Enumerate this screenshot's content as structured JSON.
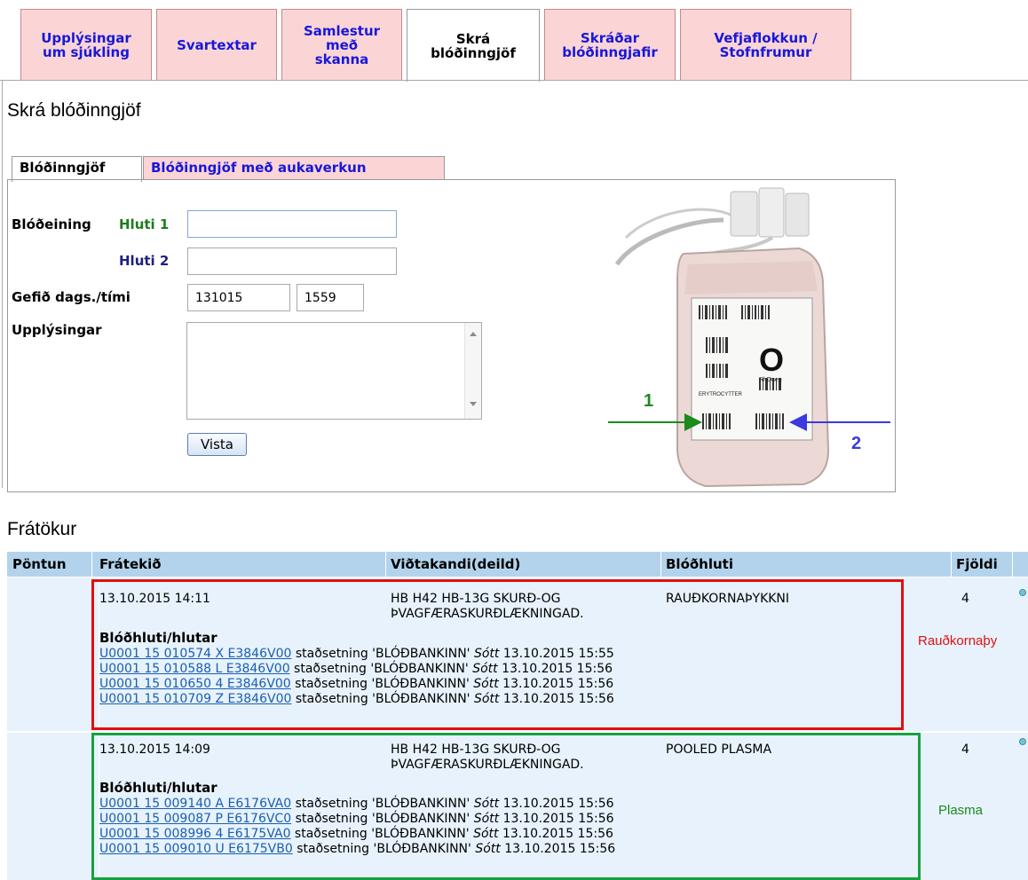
{
  "top_tabs": [
    {
      "label": "Upplýsingar\num sjúkling",
      "active": false
    },
    {
      "label": "Svartextar",
      "active": false
    },
    {
      "label": "Samlestur\nmeð\nskanna",
      "active": false
    },
    {
      "label": "Skrá\nblóðinngjöf",
      "active": true
    },
    {
      "label": "Skráðar\nblóðinngjafir",
      "active": false
    },
    {
      "label": "Vefjaflokkun /\nStofnfrumur",
      "active": false
    }
  ],
  "page_title": "Skrá blóðinngjöf",
  "inner_tabs": [
    {
      "label": "Blóðinngjöf",
      "active": true
    },
    {
      "label": "Blóðinngjöf með aukaverkun",
      "active": false
    }
  ],
  "form": {
    "unit_label": "Blóðeining",
    "part1_label": "Hluti 1",
    "part2_label": "Hluti 2",
    "part1_value": "",
    "part2_value": "",
    "given_label": "Gefið dags./tími",
    "date_value": "131015",
    "time_value": "1559",
    "info_label": "Upplýsingar",
    "info_value": "",
    "save_label": "Vista"
  },
  "bag_image": {
    "blood_group": "O",
    "rh": "RhDneg",
    "product": "ERYTROCYTTER",
    "arrow1_label": "1",
    "arrow2_label": "2",
    "arrow1_color": "#1c8a1c",
    "arrow2_color": "#3a3ae0"
  },
  "reservations_title": "Frátökur",
  "table": {
    "headers": [
      "Pöntun",
      "Frátekið",
      "Viðtakandi(deild)",
      "Blóðhluti",
      "Fjöldi"
    ],
    "sub_heading": "Blóðhluti/hlutar",
    "rows": [
      {
        "reserved": "13.10.2015 14:11",
        "recipient": "HB H42 HB-13G SKURÐ-OG\nÞVAGFÆRASKURÐLÆKNINGAD.",
        "component": "RAUÐKORNAÞYKKNI",
        "count": "4",
        "note": "Rauðkornaþy",
        "highlight_color": "#e01010",
        "note_color": "#e01010",
        "units": [
          {
            "code": "U0001 15 010574 X E3846V00",
            "loc": " staðsetning 'BLÓÐBANKINN' ",
            "fetched": "Sótt",
            "time": " 13.10.2015 15:55"
          },
          {
            "code": "U0001 15 010588 L E3846V00",
            "loc": " staðsetning 'BLÓÐBANKINN' ",
            "fetched": "Sótt",
            "time": " 13.10.2015 15:56"
          },
          {
            "code": "U0001 15 010650 4 E3846V00",
            "loc": " staðsetning 'BLÓÐBANKINN' ",
            "fetched": "Sótt",
            "time": " 13.10.2015 15:56"
          },
          {
            "code": "U0001 15 010709 Z E3846V00",
            "loc": " staðsetning 'BLÓÐBANKINN' ",
            "fetched": "Sótt",
            "time": " 13.10.2015 15:56"
          }
        ]
      },
      {
        "reserved": "13.10.2015 14:09",
        "recipient": "HB H42 HB-13G SKURÐ-OG\nÞVAGFÆRASKURÐLÆKNINGAD.",
        "component": "POOLED PLASMA",
        "count": "4",
        "note": "Plasma",
        "highlight_color": "#18a040",
        "note_color": "#1c8a1c",
        "units": [
          {
            "code": "U0001 15 009140 A E6176VA0",
            "loc": " staðsetning 'BLÓÐBANKINN' ",
            "fetched": "Sótt",
            "time": " 13.10.2015 15:56"
          },
          {
            "code": "U0001 15 009087 P E6176VC0",
            "loc": " staðsetning 'BLÓÐBANKINN' ",
            "fetched": "Sótt",
            "time": " 13.10.2015 15:56"
          },
          {
            "code": "U0001 15 008996 4 E6175VA0",
            "loc": " staðsetning 'BLÓÐBANKINN' ",
            "fetched": "Sótt",
            "time": " 13.10.2015 15:56"
          },
          {
            "code": "U0001 15 009010 U E6175VB0",
            "loc": " staðsetning 'BLÓÐBANKINN' ",
            "fetched": "Sótt",
            "time": " 13.10.2015 15:56"
          }
        ]
      }
    ]
  }
}
